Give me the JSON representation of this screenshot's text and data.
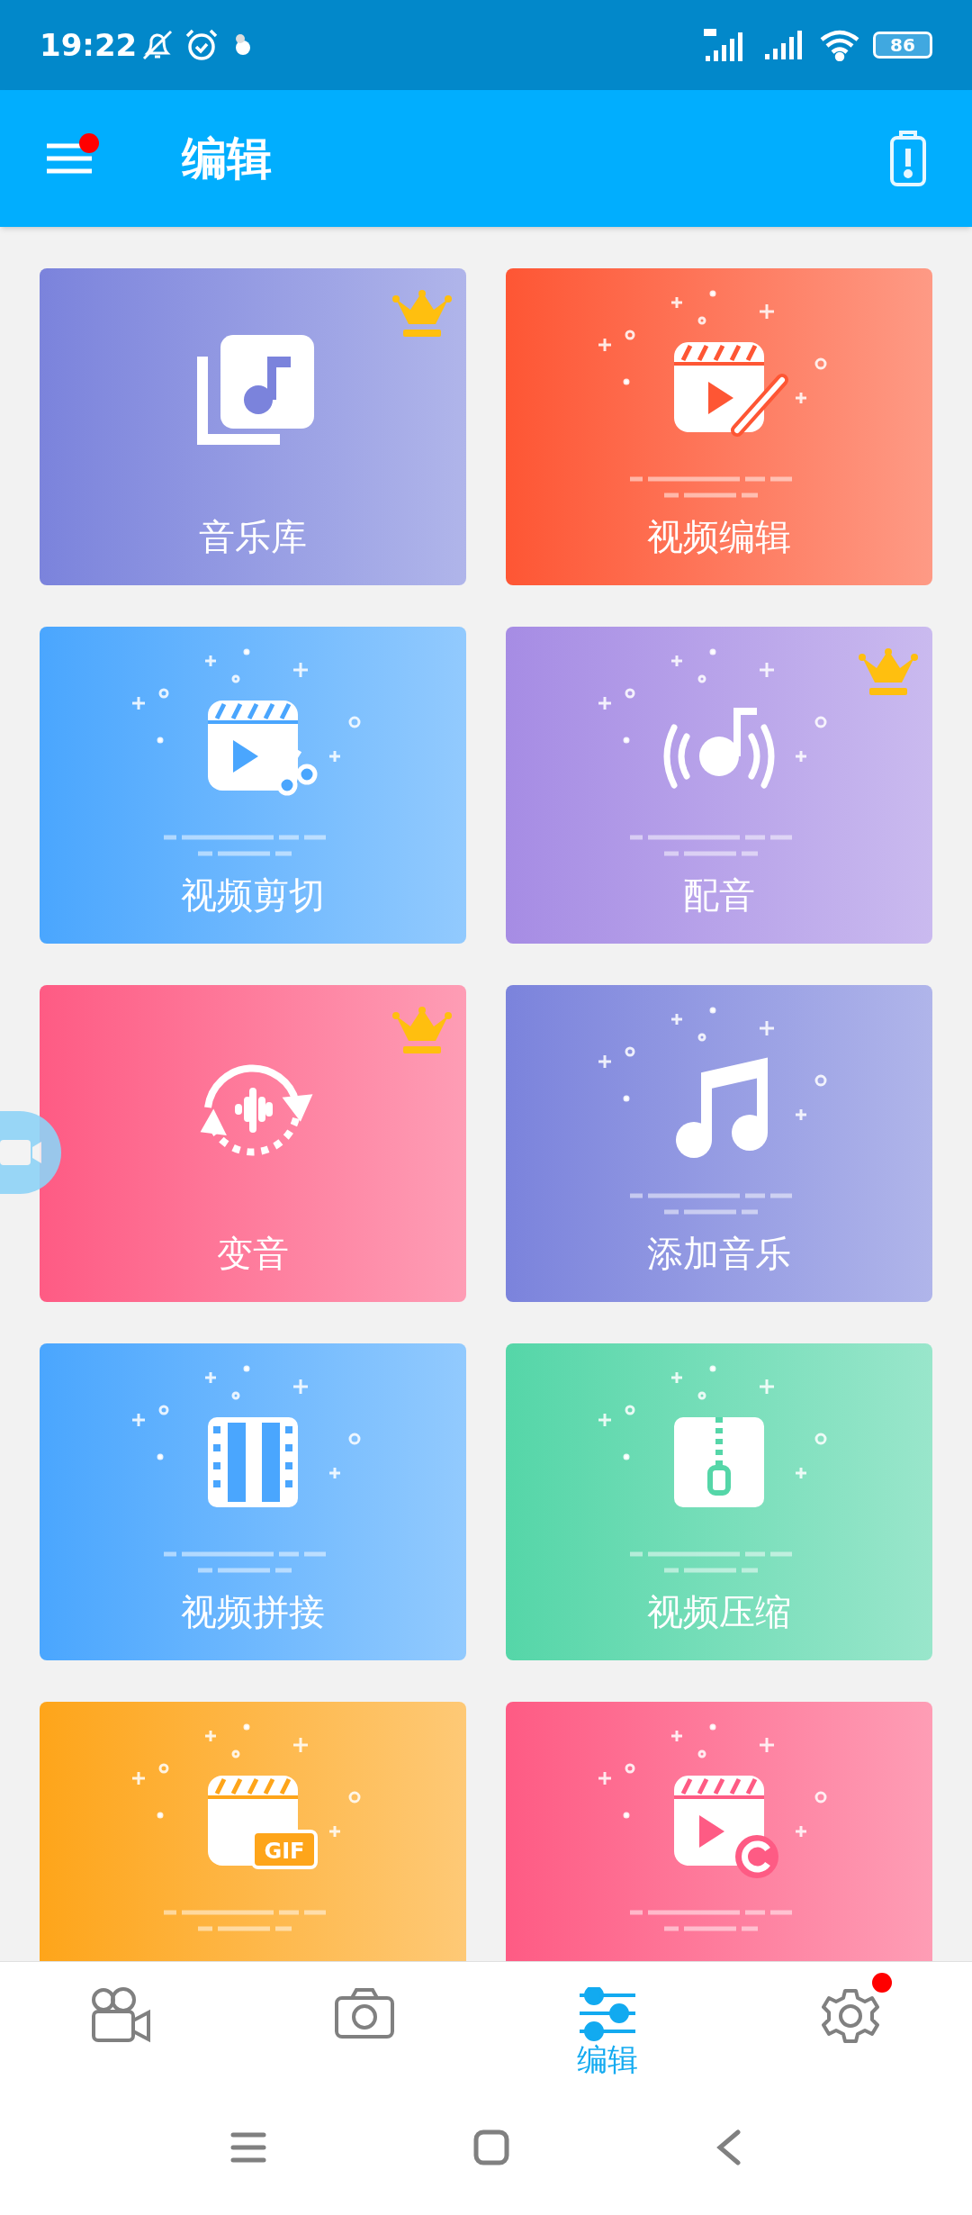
{
  "status_bar": {
    "time": "19:22",
    "battery": "86"
  },
  "header": {
    "title": "编辑",
    "menu_badge": true
  },
  "cards": [
    {
      "title": "音乐库",
      "kind": "library",
      "premium": true,
      "decorated": false,
      "color": "#7b83dc"
    },
    {
      "title": "视频编辑",
      "kind": "edit",
      "premium": false,
      "decorated": true,
      "color": "#fe5634"
    },
    {
      "title": "视频剪切",
      "kind": "cut",
      "premium": false,
      "decorated": true,
      "color": "#4aa6fe"
    },
    {
      "title": "配音",
      "kind": "dub",
      "premium": true,
      "decorated": true,
      "color": "#a68ce4"
    },
    {
      "title": "变音",
      "kind": "voice",
      "premium": true,
      "decorated": false,
      "color": "#fe5b84"
    },
    {
      "title": "添加音乐",
      "kind": "music",
      "premium": false,
      "decorated": true,
      "color": "#7b83dc"
    },
    {
      "title": "视频拼接",
      "kind": "merge",
      "premium": false,
      "decorated": true,
      "color": "#4aa6fe"
    },
    {
      "title": "视频压缩",
      "kind": "compress",
      "premium": false,
      "decorated": true,
      "color": "#55d6a8"
    },
    {
      "kind": "gif",
      "icon_label": "GIF",
      "premium": false,
      "decorated": true,
      "color": "#fea51a"
    },
    {
      "kind": "rotate",
      "premium": false,
      "decorated": true,
      "color": "#fe5b84"
    }
  ],
  "bottom_nav": [
    {
      "kind": "video",
      "selected": false,
      "badge": false
    },
    {
      "kind": "camera",
      "selected": false,
      "badge": false
    },
    {
      "kind": "edit",
      "label": "编辑",
      "selected": true,
      "badge": false
    },
    {
      "kind": "settings",
      "selected": false,
      "badge": true
    }
  ],
  "system_nav": [
    {
      "kind": "recents"
    },
    {
      "kind": "home"
    },
    {
      "kind": "back"
    }
  ]
}
